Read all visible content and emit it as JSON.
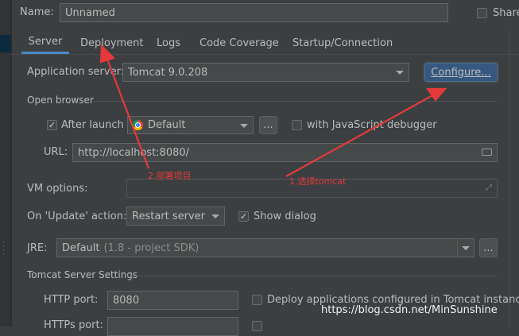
{
  "header": {
    "name_label": "Name:",
    "name_value": "Unnamed",
    "share_label": "Share"
  },
  "tabs": [
    {
      "label": "Server"
    },
    {
      "label": "Deployment"
    },
    {
      "label": "Logs"
    },
    {
      "label": "Code Coverage"
    },
    {
      "label": "Startup/Connection"
    }
  ],
  "server": {
    "app_server_label": "Application server:",
    "app_server_value": "Tomcat 9.0.208",
    "configure_label": "Configure..."
  },
  "open_browser": {
    "section_title": "Open browser",
    "after_launch_label": "After launch",
    "after_launch_checked": true,
    "browser_value": "Default",
    "browse_button": "...",
    "js_debugger_label": "with JavaScript debugger",
    "js_debugger_checked": false,
    "url_label": "URL:",
    "url_value": "http://localhost:8080/"
  },
  "vm_options": {
    "label": "VM options:",
    "value": ""
  },
  "on_update": {
    "label": "On 'Update' action:",
    "value": "Restart server",
    "show_dialog_label": "Show dialog",
    "show_dialog_checked": true
  },
  "jre": {
    "label": "JRE:",
    "value": "Default",
    "hint": "(1.8 - project SDK)",
    "browse_button": "..."
  },
  "tomcat_settings": {
    "section_title": "Tomcat Server Settings",
    "http_port_label": "HTTP port:",
    "http_port_value": "8080",
    "deploy_label": "Deploy applications configured in Tomcat instance",
    "https_port_label": "HTTPs port:"
  },
  "annotations": {
    "step1": "1.选择tomcat",
    "step2": "2.部署项目",
    "color": "#e43a3a"
  },
  "watermark": "https://blog.csdn.net/MinSunshine",
  "colors": {
    "background": "#3c3f41",
    "field": "#45494a",
    "accent": "#4a88c7",
    "configure_button": "#365880"
  }
}
